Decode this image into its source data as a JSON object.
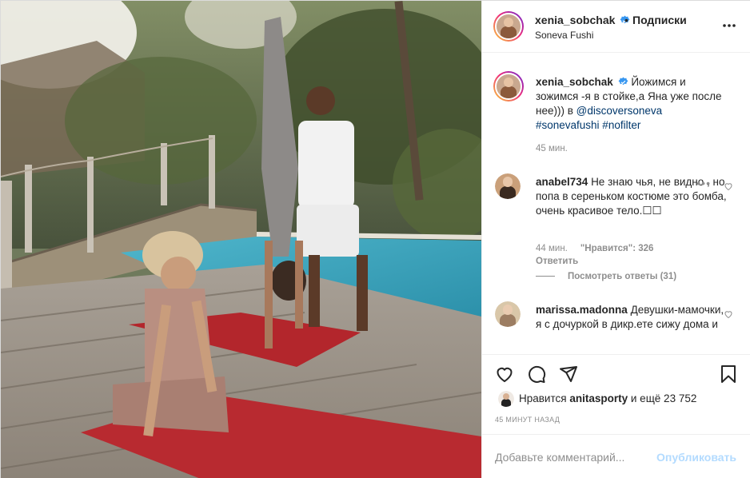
{
  "header": {
    "username": "xenia_sobchak",
    "separator": "•",
    "follow_label": "Подписки",
    "location": "Soneva Fushi"
  },
  "caption": {
    "username": "xenia_sobchak",
    "text": "Йожимся и зожимся -я в стойке,а Яна уже после нее))) в ",
    "mention": "@discoversoneva",
    "tags": "#sonevafushi #nofilter",
    "time": "45 мин."
  },
  "comments": [
    {
      "username": "anabel734",
      "text": "Не знаю чья, не видно , но попа в сереньком костюме это бомба, очень красивое тело.☐☐",
      "time": "44 мин.",
      "likes_label": "\"Нравится\": 326",
      "reply_label": "Ответить",
      "view_replies": "Посмотреть ответы (31)"
    },
    {
      "username": "marissa.madonna",
      "text": "Девушки-мамочки, я с дочуркой в дикр.ете сижу дома и"
    }
  ],
  "likes": {
    "prefix": "Нравится",
    "user": "anitasporty",
    "suffix": "и ещё 23 752"
  },
  "timestamp": "45 МИНУТ НАЗАД",
  "add_comment": {
    "placeholder": "Добавьте комментарий...",
    "publish_label": "Опубликовать"
  },
  "colors": {
    "verified": "#3897f0",
    "link": "#00376b",
    "muted": "#8e8e8e",
    "publish_disabled": "#b3dbff"
  },
  "icons": [
    "more-options-icon",
    "verified-badge-icon",
    "heart-icon",
    "comment-icon",
    "share-icon",
    "bookmark-icon"
  ]
}
